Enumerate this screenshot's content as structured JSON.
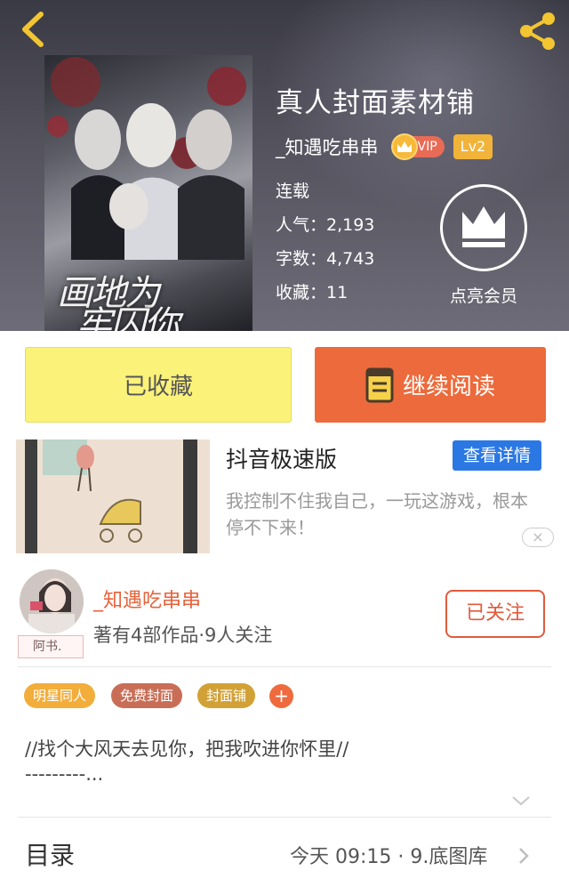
{
  "colors": {
    "accent": "#ec6a3b",
    "saved_button": "#fbf27a",
    "ad_button": "#2b78e4",
    "vip_badge": "#e86b56",
    "level_badge": "#f1b339",
    "author_name": "#e8623a"
  },
  "header": {
    "back_icon": "back-chevron-icon",
    "share_icon": "share-icon"
  },
  "book": {
    "cover_text_1": "画地为",
    "cover_text_2": "牢囚你",
    "title": "真人封面素材铺",
    "author": "_知遇吃串串",
    "vip_label": "VIP",
    "level": "Lv2",
    "status": "连载",
    "popularity": "人气：2,193",
    "word_count": "字数：4,743",
    "favorites": "收藏：11",
    "member_label": "点亮会员"
  },
  "actions": {
    "saved_label": "已收藏",
    "continue_label": "继续阅读"
  },
  "ad": {
    "title": "抖音极速版",
    "button_label": "查看详情",
    "description": "我控制不住我自己，一玩这游戏，根本停不下来！",
    "close_label": "×"
  },
  "author_card": {
    "avatar_tag": "阿书.",
    "name": "_知遇吃串串",
    "info": "著有4部作品·9人关注",
    "follow_label": "已关注"
  },
  "tags": [
    {
      "label": "明星同人",
      "color": "#f2ad3a"
    },
    {
      "label": "免费封面",
      "color": "#c96e56"
    },
    {
      "label": "封面铺",
      "color": "#d2a136"
    }
  ],
  "tag_add_label": "+",
  "intro": {
    "line1": "//找个大风天去见你，把我吹进你怀里//",
    "line2": "---------..."
  },
  "toc": {
    "label": "目录",
    "update": "今天 09:15 · 9.底图库"
  }
}
